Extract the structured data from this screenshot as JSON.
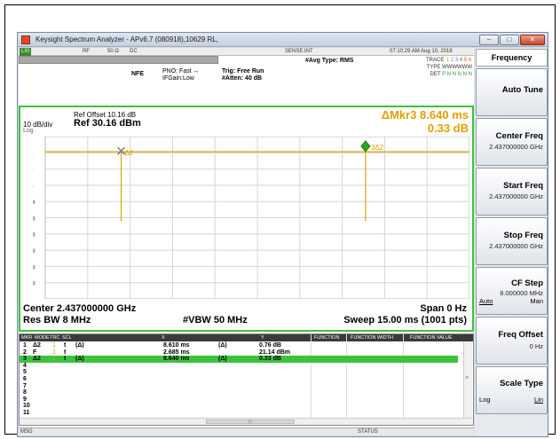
{
  "window": {
    "title": "Keysight Spectrum Analyzer - APv6.7 (080918),10629 RL,",
    "min_glyph": "–",
    "max_glyph": "□",
    "close_glyph": "✕"
  },
  "status_row": {
    "lxi": "LXI",
    "rf": "RF",
    "impedance": "50 Ω",
    "coupling": "DC",
    "sense": "SENSE:INT",
    "datetime": "07:10:29 AM Aug 10, 2018"
  },
  "header": {
    "nfe": "NFE",
    "pno": "PNO: Fast",
    "pno_arrow": "↔",
    "ifgain": "IFGain:Low",
    "trig": "Trig: Free Run",
    "atten": "#Atten: 40 dB",
    "avg_type": "#Avg Type: RMS",
    "trace_label": "TRACE",
    "trace_digits": [
      "1",
      "2",
      "3",
      "4",
      "5",
      "6"
    ],
    "type_label": "TYPE",
    "type_value": "WWWWWW",
    "det_label": "DET",
    "det_value": "P N N N N N"
  },
  "display": {
    "ref_offset": "Ref Offset 10.16 dB",
    "ref_level": "Ref 30.16 dBm",
    "scale": "10 dB/div",
    "log": "Log",
    "marker_readout_line1": "ΔMkr3 8.640 ms",
    "marker_readout_line2": "0.33 dB",
    "y_ticks": [
      "20.2",
      "10.2",
      "0.160",
      "-9.84",
      "-19.8",
      "-29.8",
      "-39.8",
      "-49.8",
      "-59.8"
    ],
    "marker1_label": "Δ2",
    "marker3_label": "3Δ2",
    "center": "Center 2.437000000 GHz",
    "res_bw": "Res BW 8 MHz",
    "vbw": "#VBW 50 MHz",
    "span": "Span 0 Hz",
    "sweep": "Sweep  15.00 ms (1001 pts)"
  },
  "colors": {
    "accent_green": "#3cc33c",
    "trace_yellow": "#e0a000",
    "marker_green": "#22aa22"
  },
  "chart_data": {
    "type": "line",
    "title": "",
    "xlabel": "",
    "ylabel": "",
    "x_range_ms": [
      0,
      15
    ],
    "ylim": [
      -69.84,
      30.16
    ],
    "y_ticks": [
      20.2,
      10.2,
      0.16,
      -9.84,
      -19.8,
      -29.8,
      -39.8,
      -49.8,
      -59.8
    ],
    "grid": true,
    "series": [
      {
        "trace_level_dbm": 20.8,
        "spikes": [
          {
            "t_ms": 2.685,
            "bottom_dbm": -22
          },
          {
            "t_ms": 11.325,
            "bottom_dbm": -22
          }
        ]
      }
    ],
    "markers": [
      {
        "label": "Δ2",
        "t_ms": 2.685,
        "level_dbm": 20.8,
        "shape": "x"
      },
      {
        "label": "3Δ2",
        "t_ms": 11.325,
        "level_dbm": 21.5,
        "shape": "diamond"
      }
    ]
  },
  "marker_table": {
    "headers": [
      "MKR",
      "MODE",
      "TRC",
      "SCL",
      "X",
      "Y",
      "FUNCTION",
      "FUNCTION WIDTH",
      "FUNCTION VALUE"
    ],
    "rows": [
      {
        "mkr": "1",
        "mode": "Δ2",
        "trc": "1",
        "scl": "t",
        "delta": "(Δ)",
        "x": "8.610 ms",
        "ydelta": "(Δ)",
        "y": "0.76 dB"
      },
      {
        "mkr": "2",
        "mode": "F",
        "trc": "1",
        "scl": "t",
        "delta": "",
        "x": "2.685 ms",
        "ydelta": "",
        "y": "21.14 dBm"
      },
      {
        "mkr": "3",
        "mode": "Δ2",
        "trc": "1",
        "scl": "t",
        "delta": "(Δ)",
        "x": "8.640 ms",
        "ydelta": "(Δ)",
        "y": "0.33 dB"
      },
      {
        "mkr": "4",
        "mode": "",
        "trc": "",
        "scl": "",
        "delta": "",
        "x": "",
        "ydelta": "",
        "y": ""
      },
      {
        "mkr": "5",
        "mode": "",
        "trc": "",
        "scl": "",
        "delta": "",
        "x": "",
        "ydelta": "",
        "y": ""
      },
      {
        "mkr": "6",
        "mode": "",
        "trc": "",
        "scl": "",
        "delta": "",
        "x": "",
        "ydelta": "",
        "y": ""
      },
      {
        "mkr": "7",
        "mode": "",
        "trc": "",
        "scl": "",
        "delta": "",
        "x": "",
        "ydelta": "",
        "y": ""
      },
      {
        "mkr": "8",
        "mode": "",
        "trc": "",
        "scl": "",
        "delta": "",
        "x": "",
        "ydelta": "",
        "y": ""
      },
      {
        "mkr": "9",
        "mode": "",
        "trc": "",
        "scl": "",
        "delta": "",
        "x": "",
        "ydelta": "",
        "y": ""
      },
      {
        "mkr": "10",
        "mode": "",
        "trc": "",
        "scl": "",
        "delta": "",
        "x": "",
        "ydelta": "",
        "y": ""
      },
      {
        "mkr": "11",
        "mode": "",
        "trc": "",
        "scl": "",
        "delta": "",
        "x": "",
        "ydelta": "",
        "y": ""
      }
    ],
    "scroll_mark": "≡",
    "hscroll_mark": "III"
  },
  "bottom_bar": {
    "msg": "MSG",
    "status": "STATUS"
  },
  "softkeys": {
    "title": "Frequency",
    "auto_tune": "Auto Tune",
    "center_freq": {
      "label": "Center Freq",
      "value": "2.437000000 GHz"
    },
    "start_freq": {
      "label": "Start Freq",
      "value": "2.437000000 GHz"
    },
    "stop_freq": {
      "label": "Stop Freq",
      "value": "2.437000000 GHz"
    },
    "cf_step": {
      "label": "CF Step",
      "value": "8.000000 MHz",
      "opt_auto": "Auto",
      "opt_man": "Man"
    },
    "freq_offset": {
      "label": "Freq Offset",
      "value": "0 Hz"
    },
    "scale_type": {
      "label": "Scale Type",
      "opt_log": "Log",
      "opt_lin": "Lin"
    }
  }
}
